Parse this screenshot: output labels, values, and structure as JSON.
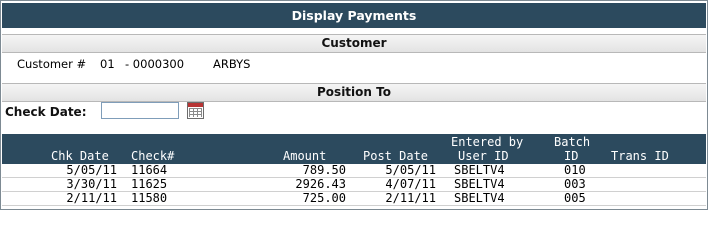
{
  "title": "Display Payments",
  "customer_section": {
    "heading": "Customer",
    "label": "Customer #",
    "code": "01",
    "number": "- 0000300",
    "name": "ARBYS"
  },
  "position_section": {
    "heading": "Position To",
    "check_date_label": "Check Date:",
    "check_date_value": ""
  },
  "table": {
    "headers": {
      "chk_date": "Chk Date",
      "check_no": "Check#",
      "amount": "Amount",
      "post_date": "Post Date",
      "entered_by_top": "Entered by",
      "user_id": "User ID",
      "batch_top": "Batch",
      "batch_id": "ID",
      "trans_id": "Trans ID"
    },
    "rows": [
      {
        "chk_date": "5/05/11",
        "check_no": "11664",
        "amount": "789.50",
        "post_date": "5/05/11",
        "user_id": "SBELTV4",
        "batch_id": "010",
        "trans_id": ""
      },
      {
        "chk_date": "3/30/11",
        "check_no": "11625",
        "amount": "2926.43",
        "post_date": "4/07/11",
        "user_id": "SBELTV4",
        "batch_id": "003",
        "trans_id": ""
      },
      {
        "chk_date": "2/11/11",
        "check_no": "11580",
        "amount": "725.00",
        "post_date": "2/11/11",
        "user_id": "SBELTV4",
        "batch_id": "005",
        "trans_id": ""
      }
    ]
  }
}
